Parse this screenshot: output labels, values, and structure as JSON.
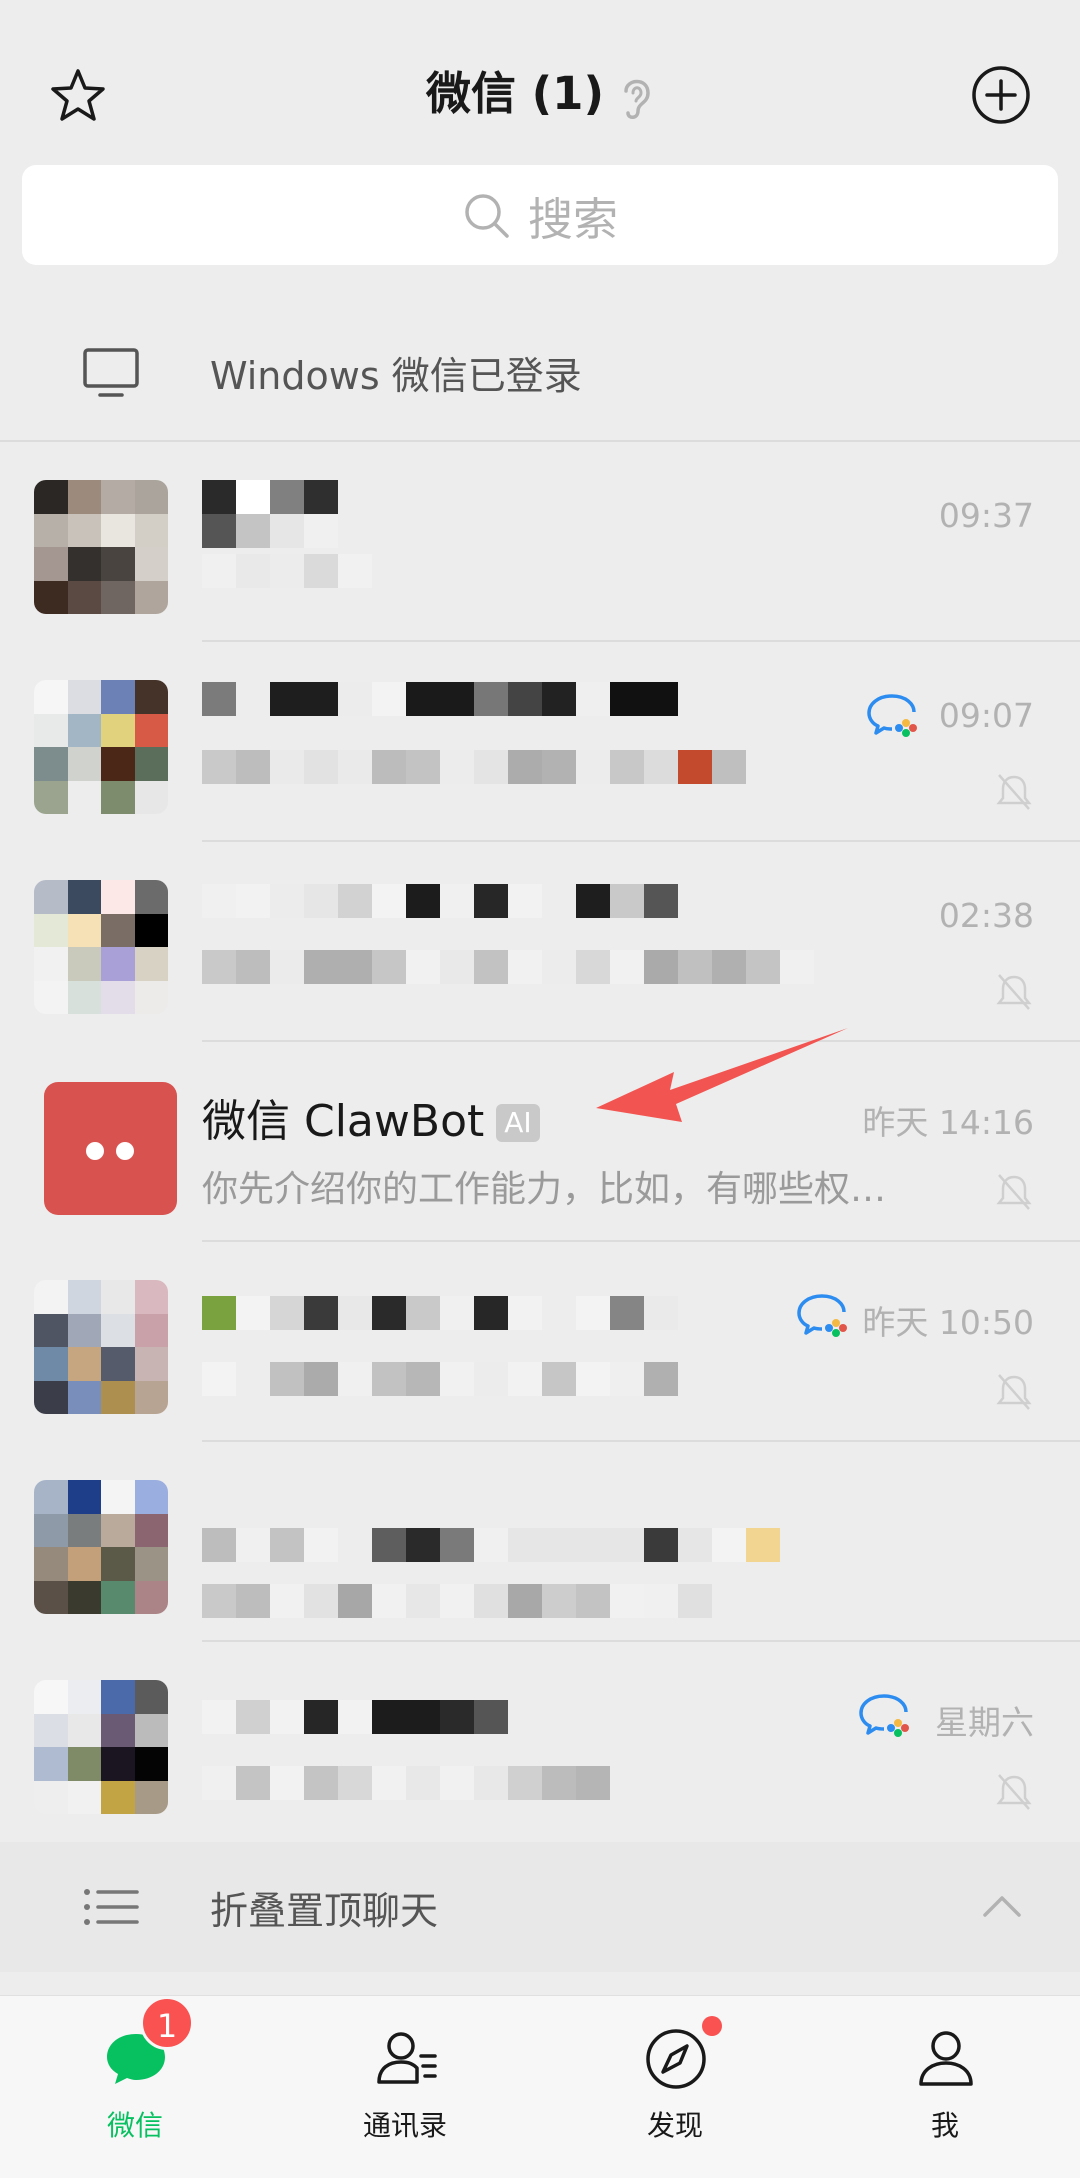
{
  "header": {
    "title": "微信 (1)",
    "icons": [
      "star-icon",
      "ear-icon",
      "plus-circle-icon"
    ]
  },
  "search": {
    "placeholder": "搜索"
  },
  "login_notice": {
    "text": "Windows 微信已登录"
  },
  "chats": [
    {
      "time": "09:37",
      "obscured": true
    },
    {
      "time": "09:07",
      "obscured": true,
      "wecom": true,
      "muted": true
    },
    {
      "time": "02:38",
      "obscured": true,
      "muted": true
    },
    {
      "name": "微信 ClawBot",
      "badge": "AI",
      "preview": "你先介绍你的工作能力，比如，有哪些权…",
      "time": "昨天 14:16",
      "muted": true
    },
    {
      "time": "昨天 10:50",
      "obscured": true,
      "wecom": true,
      "muted": true
    },
    {
      "time": "",
      "obscured": true,
      "muted": true
    },
    {
      "time": "星期六",
      "obscured": true,
      "wecom": true,
      "muted": true
    }
  ],
  "folded": {
    "label": "折叠置顶聊天"
  },
  "tabbar": {
    "tabs": [
      {
        "label": "微信",
        "badge": "1",
        "active": true
      },
      {
        "label": "通讯录"
      },
      {
        "label": "发现",
        "dot": true
      },
      {
        "label": "我"
      }
    ]
  },
  "colors": {
    "accent": "#07c160",
    "badge": "#fa5151",
    "bot_avatar": "#d85350",
    "annotation_arrow": "#f25551"
  }
}
